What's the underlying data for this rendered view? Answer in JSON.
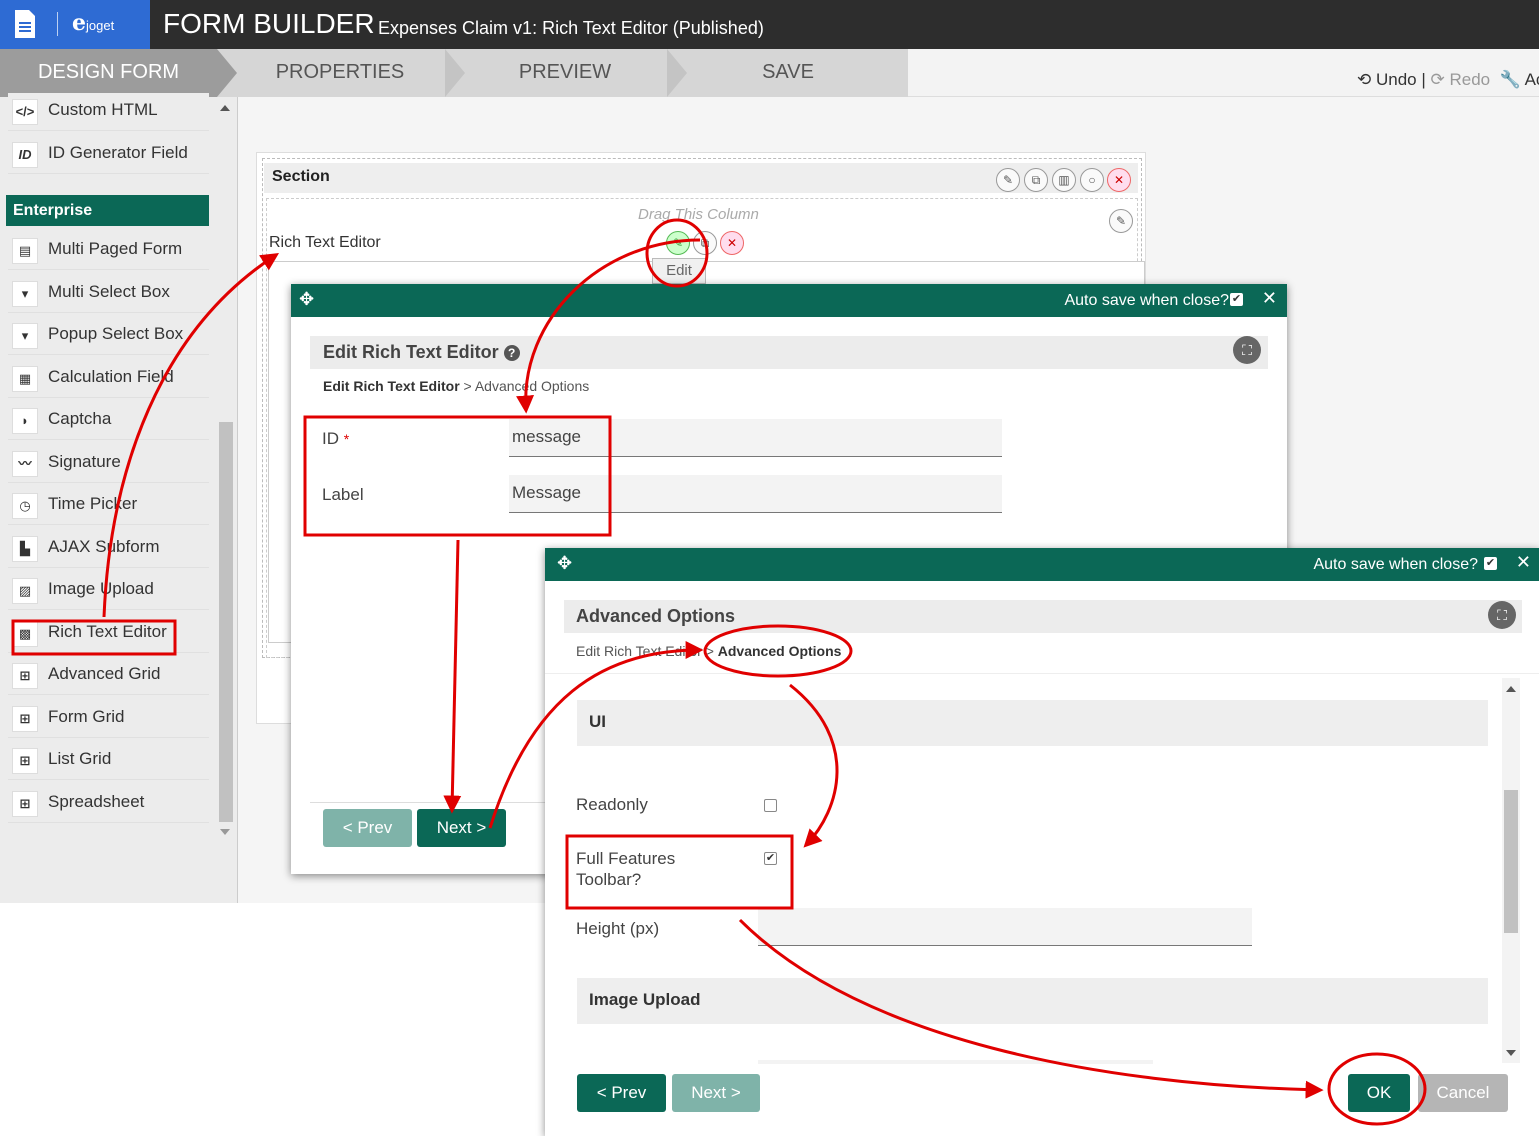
{
  "header": {
    "app_title": "FORM BUILDER",
    "subtitle": "Expenses Claim v1: Rich Text Editor (Published)",
    "logo_text": "joget"
  },
  "steps": [
    "DESIGN FORM",
    "PROPERTIES",
    "PREVIEW",
    "SAVE"
  ],
  "toolbar": {
    "undo": "Undo",
    "separator": "|",
    "redo": "Redo",
    "advanced": "Ac"
  },
  "palette": {
    "top_items": [
      {
        "icon": "</>",
        "label": "Custom HTML"
      },
      {
        "icon": "ID",
        "label": "ID Generator Field"
      }
    ],
    "enterprise_header": "Enterprise",
    "enterprise_items": [
      {
        "icon": "▤",
        "label": "Multi Paged Form"
      },
      {
        "icon": "▾",
        "label": "Multi Select Box"
      },
      {
        "icon": "▾",
        "label": "Popup Select Box"
      },
      {
        "icon": "▦",
        "label": "Calculation Field"
      },
      {
        "icon": "◗",
        "label": "Captcha"
      },
      {
        "icon": "〰",
        "label": "Signature"
      },
      {
        "icon": "◷",
        "label": "Time Picker"
      },
      {
        "icon": "▙",
        "label": "AJAX Subform"
      },
      {
        "icon": "▨",
        "label": "Image Upload"
      },
      {
        "icon": "▩",
        "label": "Rich Text Editor"
      },
      {
        "icon": "⊞",
        "label": "Advanced Grid"
      },
      {
        "icon": "⊞",
        "label": "Form Grid"
      },
      {
        "icon": "⊞",
        "label": "List Grid"
      },
      {
        "icon": "⊞",
        "label": "Spreadsheet"
      }
    ]
  },
  "canvas": {
    "section_title": "Section",
    "drag_column": "Drag This Column",
    "element_label": "Rich Text Editor",
    "edit_tooltip": "Edit"
  },
  "dialog1": {
    "auto_save": "Auto save when close?",
    "title": "Edit Rich Text Editor",
    "help_icon": "?",
    "crumb_current": "Edit Rich Text Editor",
    "crumb_sep": ">",
    "crumb_next": "Advanced Options",
    "id_label": "ID",
    "id_required": "*",
    "id_value": "message",
    "label_label": "Label",
    "label_value": "Message",
    "prev_button": "< Prev",
    "next_button": "Next >"
  },
  "dialog2": {
    "auto_save": "Auto save when close?",
    "title": "Advanced Options",
    "crumb_prev": "Edit Rich Text Editor",
    "crumb_sep": ">",
    "crumb_current": "Advanced Options",
    "group_ui": "UI",
    "readonly_label": "Readonly",
    "readonly_checked": false,
    "full_toolbar_label": "Full Features Toolbar?",
    "full_toolbar_checked": true,
    "height_label": "Height (px)",
    "height_value": "",
    "group_image": "Image Upload",
    "prev_button": "< Prev",
    "next_button": "Next >",
    "ok_button": "OK",
    "cancel_button": "Cancel"
  },
  "colors": {
    "brand_green": "#0b6856",
    "logo_blue": "#2e6bd3",
    "topbar": "#2d2d2d",
    "annotation_red": "#e00000"
  }
}
